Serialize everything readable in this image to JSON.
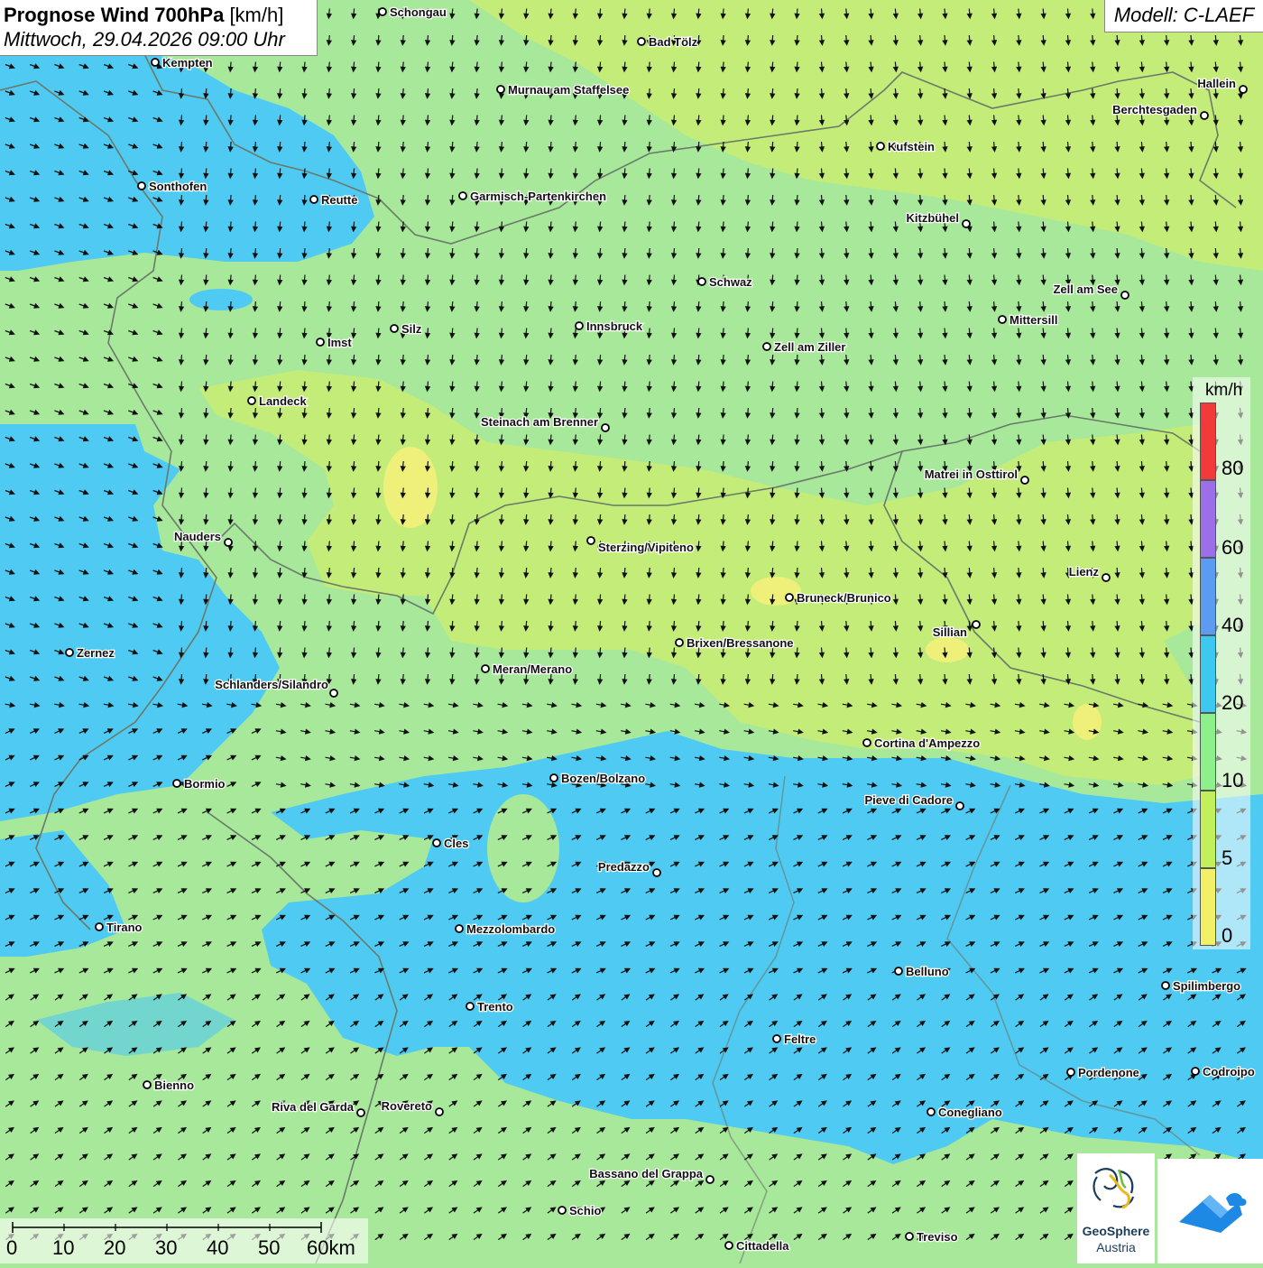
{
  "header": {
    "title_bold": "Prognose Wind 700hPa",
    "title_unit": "[km/h]",
    "date": "Mittwoch, 29.04.2026 09:00 Uhr",
    "model": "Modell: C-LAEF"
  },
  "legend": {
    "unit": "km/h",
    "classes": [
      {
        "label": "80",
        "color": "#f23a3a"
      },
      {
        "label": "60",
        "color": "#9b6fe8"
      },
      {
        "label": "40",
        "color": "#5b9cf2"
      },
      {
        "label": "20",
        "color": "#3cc8f0"
      },
      {
        "label": "10",
        "color": "#8ef08a"
      },
      {
        "label": "5",
        "color": "#c2f05a"
      },
      {
        "label": "0",
        "color": "#f2f066"
      }
    ]
  },
  "scale": {
    "labels": [
      "0",
      "10",
      "20",
      "30",
      "40",
      "50",
      "60km"
    ]
  },
  "logos": {
    "geosphere_line1": "GeoSphere",
    "geosphere_line2": "Austria"
  },
  "cities": [
    {
      "name": "Schongau"
    },
    {
      "name": "Bad Tölz"
    },
    {
      "name": "Kempten"
    },
    {
      "name": "Murnau am Staffelsee"
    },
    {
      "name": "Hallein"
    },
    {
      "name": "Berchtesgaden"
    },
    {
      "name": "Kufstein"
    },
    {
      "name": "Sonthofen"
    },
    {
      "name": "Reutte"
    },
    {
      "name": "Garmisch-Partenkirchen"
    },
    {
      "name": "Kitzbühel"
    },
    {
      "name": "Schwaz"
    },
    {
      "name": "Zell am See"
    },
    {
      "name": "Innsbruck"
    },
    {
      "name": "Silz"
    },
    {
      "name": "Mittersill"
    },
    {
      "name": "Imst"
    },
    {
      "name": "Zell am Ziller"
    },
    {
      "name": "Landeck"
    },
    {
      "name": "Steinach am Brenner"
    },
    {
      "name": "Matrei in Osttirol"
    },
    {
      "name": "Nauders"
    },
    {
      "name": "Sterzing/Vipiteno"
    },
    {
      "name": "Lienz"
    },
    {
      "name": "Bruneck/Brunico"
    },
    {
      "name": "Sillian"
    },
    {
      "name": "Brixen/Bressanone"
    },
    {
      "name": "Zernez"
    },
    {
      "name": "Meran/Merano"
    },
    {
      "name": "Schlanders/Silandro"
    },
    {
      "name": "Cortina d'Ampezzo"
    },
    {
      "name": "Bozen/Bolzano"
    },
    {
      "name": "Bormio"
    },
    {
      "name": "Pieve di Cadore"
    },
    {
      "name": "Cles"
    },
    {
      "name": "Predazzo"
    },
    {
      "name": "Tirano"
    },
    {
      "name": "Mezzolombardo"
    },
    {
      "name": "Belluno"
    },
    {
      "name": "Spilimbergo"
    },
    {
      "name": "Trento"
    },
    {
      "name": "Feltre"
    },
    {
      "name": "Bienno"
    },
    {
      "name": "Pordenone"
    },
    {
      "name": "Codroipo"
    },
    {
      "name": "Riva del Garda"
    },
    {
      "name": "Rovereto"
    },
    {
      "name": "Conegliano"
    },
    {
      "name": "Bassano del Grappa"
    },
    {
      "name": "Schio"
    },
    {
      "name": "Treviso"
    },
    {
      "name": "Cittadella"
    }
  ]
}
